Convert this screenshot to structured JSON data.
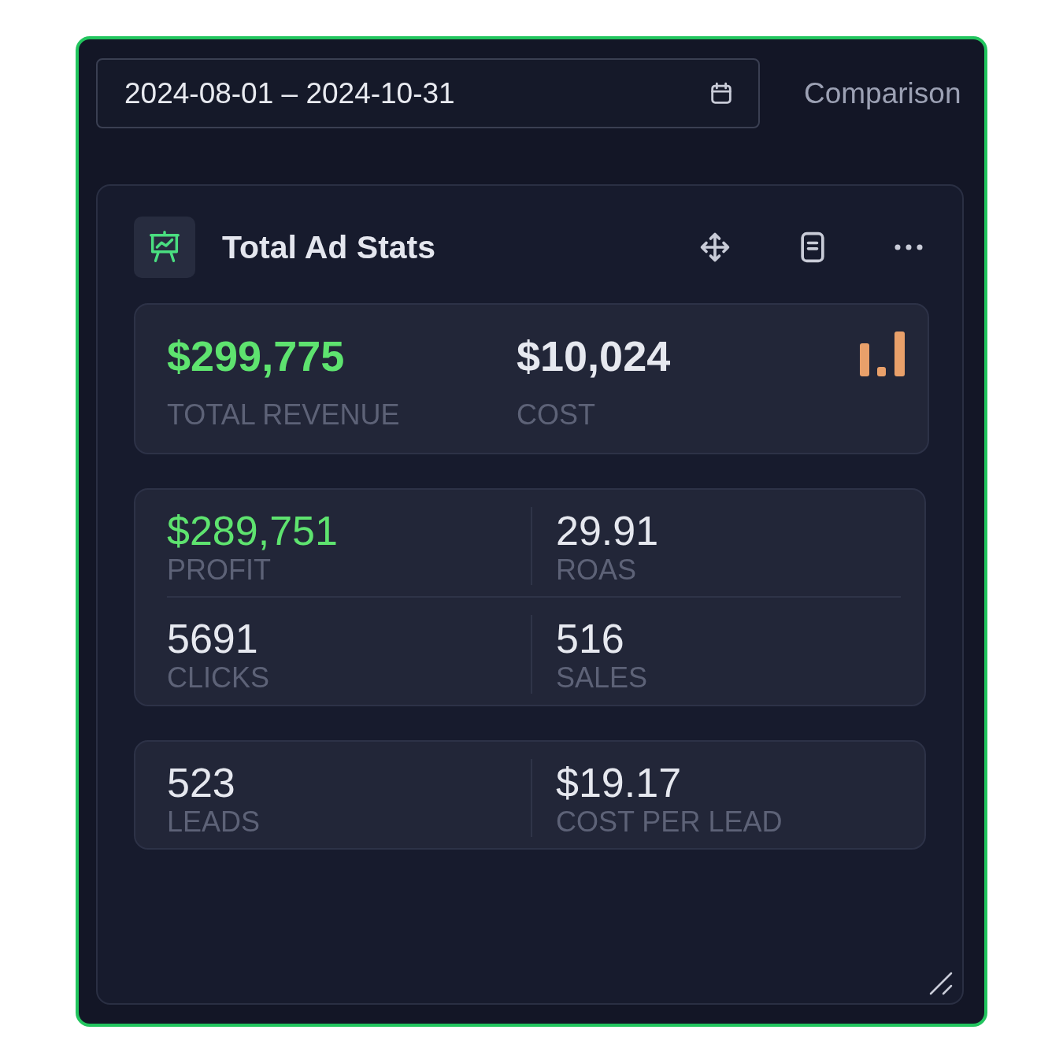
{
  "date_range": {
    "value": "2024-08-01 – 2024-10-31"
  },
  "comparison": {
    "label": "Comparison"
  },
  "card": {
    "title": "Total Ad Stats"
  },
  "tiles": [
    {
      "kind": "headline",
      "items": [
        {
          "value": "$299,775",
          "label": "TOTAL REVENUE",
          "positive": true
        },
        {
          "value": "$10,024",
          "label": "COST",
          "positive": false
        }
      ]
    },
    {
      "kind": "grid",
      "items": [
        {
          "value": "$289,751",
          "label": "PROFIT",
          "positive": true
        },
        {
          "value": "29.91",
          "label": "ROAS",
          "positive": false
        },
        {
          "value": "5691",
          "label": "CLICKS",
          "positive": false
        },
        {
          "value": "516",
          "label": "SALES",
          "positive": false
        }
      ]
    },
    {
      "kind": "grid",
      "items": [
        {
          "value": "523",
          "label": "LEADS",
          "positive": false
        },
        {
          "value": "$19.17",
          "label": "COST PER LEAD",
          "positive": false
        }
      ]
    }
  ]
}
